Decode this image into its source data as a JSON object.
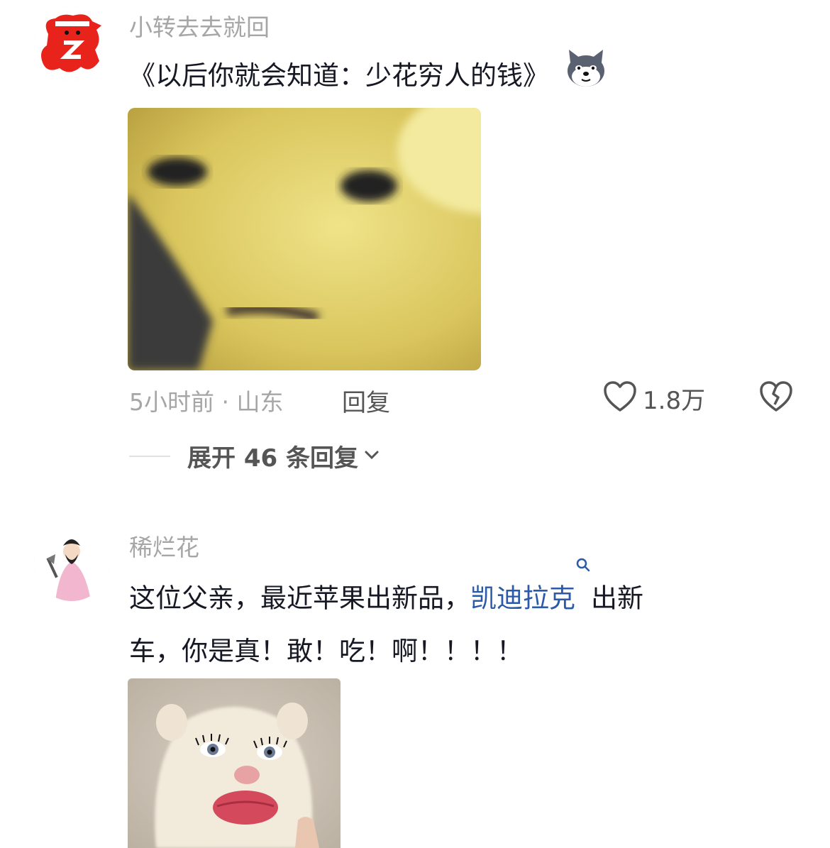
{
  "comments": [
    {
      "username": "小转去去就回",
      "text": "《以后你就会知道：少花穷人的钱》",
      "sticker_icon": "husky-dog-emoji",
      "time_location": "5小时前 · 山东",
      "reply_label": "回复",
      "like_count": "1.8万",
      "expand_label": "展开 46 条回复"
    },
    {
      "username": "稀烂花",
      "text_line1_before": "这位父亲，最近苹果出新品，",
      "link_text": "凯迪拉克",
      "text_line1_after": "出新",
      "text_line2": "车，你是真！敢！吃！啊！！！！"
    }
  ],
  "colors": {
    "username": "#a6a6a6",
    "text": "#161823",
    "link": "#2b5aa8",
    "meta": "#555555"
  }
}
